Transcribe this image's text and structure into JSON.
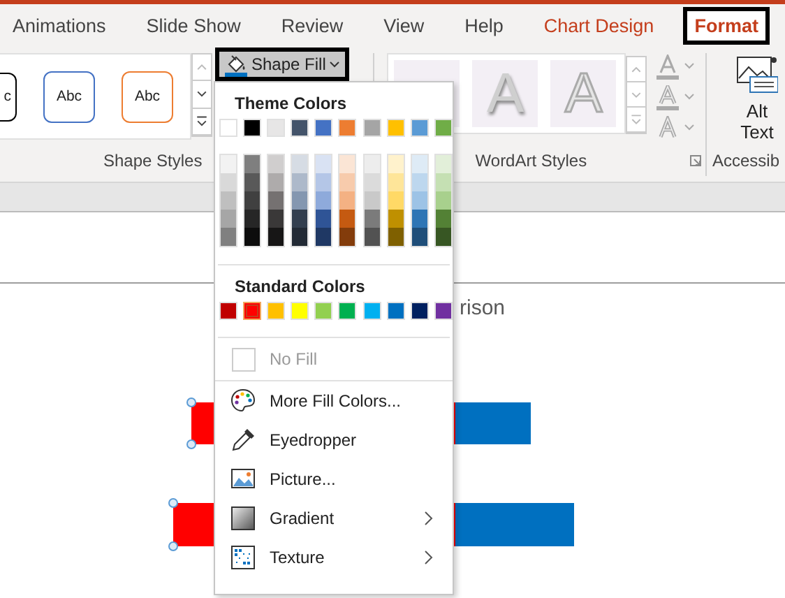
{
  "tabs": [
    {
      "label": "Animations",
      "kind": "normal",
      "selected": false
    },
    {
      "label": "Slide Show",
      "kind": "normal",
      "selected": false
    },
    {
      "label": "Review",
      "kind": "normal",
      "selected": false
    },
    {
      "label": "View",
      "kind": "normal",
      "selected": false
    },
    {
      "label": "Help",
      "kind": "normal",
      "selected": false
    },
    {
      "label": "Chart Design",
      "kind": "contextual",
      "selected": false
    },
    {
      "label": "Format",
      "kind": "contextual",
      "selected": true
    }
  ],
  "shape_styles": {
    "label": "Shape Styles",
    "items": [
      {
        "text": "c",
        "color": "#000000"
      },
      {
        "text": "Abc",
        "color": "#4472c4"
      },
      {
        "text": "Abc",
        "color": "#ed7d31"
      }
    ]
  },
  "shape_fill": {
    "label": "Shape Fill",
    "pressed": true
  },
  "wordart_styles": {
    "label": "WordArt Styles",
    "items": [
      {
        "text": "A",
        "kind": "shadow"
      },
      {
        "text": "A",
        "kind": "outline"
      }
    ]
  },
  "accessibility": {
    "label": "Accessib",
    "button": "Alt Text"
  },
  "chart": {
    "title": "rison",
    "series": [
      {
        "color": "#ff0000",
        "selected": true
      },
      {
        "color": "#0070c0",
        "selected": false
      }
    ]
  },
  "menu": {
    "theme_header": "Theme Colors",
    "theme_colors": [
      {
        "color": "#ffffff",
        "selected": false,
        "shades": [
          {
            "color": "#f2f2f2",
            "selected": false
          },
          {
            "color": "#d9d9d9",
            "selected": false
          },
          {
            "color": "#bfbfbf",
            "selected": false
          },
          {
            "color": "#a6a6a6",
            "selected": false
          },
          {
            "color": "#808080",
            "selected": false
          }
        ]
      },
      {
        "color": "#000000",
        "selected": false,
        "shades": [
          {
            "color": "#7f7f7f",
            "selected": false
          },
          {
            "color": "#595959",
            "selected": false
          },
          {
            "color": "#404040",
            "selected": false
          },
          {
            "color": "#262626",
            "selected": false
          },
          {
            "color": "#0d0d0d",
            "selected": false
          }
        ]
      },
      {
        "color": "#e7e6e6",
        "selected": false,
        "shades": [
          {
            "color": "#d0cece",
            "selected": false
          },
          {
            "color": "#aeabab",
            "selected": false
          },
          {
            "color": "#757171",
            "selected": false
          },
          {
            "color": "#3a3838",
            "selected": false
          },
          {
            "color": "#171616",
            "selected": false
          }
        ]
      },
      {
        "color": "#44546a",
        "selected": false,
        "shades": [
          {
            "color": "#d6dce4",
            "selected": false
          },
          {
            "color": "#adb9ca",
            "selected": false
          },
          {
            "color": "#8497b0",
            "selected": false
          },
          {
            "color": "#333f4f",
            "selected": false
          },
          {
            "color": "#222a35",
            "selected": false
          }
        ]
      },
      {
        "color": "#4472c4",
        "selected": false,
        "shades": [
          {
            "color": "#d9e2f3",
            "selected": false
          },
          {
            "color": "#b4c6e7",
            "selected": false
          },
          {
            "color": "#8eaadb",
            "selected": false
          },
          {
            "color": "#2f5496",
            "selected": false
          },
          {
            "color": "#1f3864",
            "selected": false
          }
        ]
      },
      {
        "color": "#ed7d31",
        "selected": false,
        "shades": [
          {
            "color": "#fbe5d5",
            "selected": false
          },
          {
            "color": "#f7cbac",
            "selected": false
          },
          {
            "color": "#f4b183",
            "selected": false
          },
          {
            "color": "#c55a11",
            "selected": false
          },
          {
            "color": "#833c0b",
            "selected": false
          }
        ]
      },
      {
        "color": "#a5a5a5",
        "selected": false,
        "shades": [
          {
            "color": "#ededed",
            "selected": false
          },
          {
            "color": "#dbdbdb",
            "selected": false
          },
          {
            "color": "#c9c9c9",
            "selected": false
          },
          {
            "color": "#7b7b7b",
            "selected": false
          },
          {
            "color": "#525252",
            "selected": false
          }
        ]
      },
      {
        "color": "#ffc000",
        "selected": false,
        "shades": [
          {
            "color": "#fff2cc",
            "selected": false
          },
          {
            "color": "#fee599",
            "selected": false
          },
          {
            "color": "#ffd966",
            "selected": false
          },
          {
            "color": "#bf9000",
            "selected": false
          },
          {
            "color": "#7f6000",
            "selected": false
          }
        ]
      },
      {
        "color": "#5b9bd5",
        "selected": false,
        "shades": [
          {
            "color": "#deebf6",
            "selected": false
          },
          {
            "color": "#bdd7ee",
            "selected": false
          },
          {
            "color": "#9dc3e6",
            "selected": false
          },
          {
            "color": "#2e75b5",
            "selected": false
          },
          {
            "color": "#1f4e79",
            "selected": false
          }
        ]
      },
      {
        "color": "#70ad47",
        "selected": false,
        "shades": [
          {
            "color": "#e2efd9",
            "selected": false
          },
          {
            "color": "#c5e0b3",
            "selected": false
          },
          {
            "color": "#a8d08d",
            "selected": false
          },
          {
            "color": "#538135",
            "selected": false
          },
          {
            "color": "#375623",
            "selected": false
          }
        ]
      }
    ],
    "standard_header": "Standard Colors",
    "standard_colors": [
      {
        "color": "#c00000",
        "selected": false
      },
      {
        "color": "#ff0000",
        "selected": true
      },
      {
        "color": "#ffc000",
        "selected": false
      },
      {
        "color": "#ffff00",
        "selected": false
      },
      {
        "color": "#92d050",
        "selected": false
      },
      {
        "color": "#00b050",
        "selected": false
      },
      {
        "color": "#00b0f0",
        "selected": false
      },
      {
        "color": "#0070c0",
        "selected": false
      },
      {
        "color": "#002060",
        "selected": false
      },
      {
        "color": "#7030a0",
        "selected": false
      }
    ],
    "no_fill": {
      "label": "No Fill",
      "disabled": true
    },
    "items": [
      {
        "label": "More Fill Colors...",
        "kind": "palette",
        "submenu": false
      },
      {
        "label": "Eyedropper",
        "kind": "eyedropper",
        "submenu": false
      },
      {
        "label": "Picture...",
        "kind": "picture",
        "submenu": false
      },
      {
        "label": "Gradient",
        "kind": "gradient",
        "submenu": true
      },
      {
        "label": "Texture",
        "kind": "texture",
        "submenu": true
      }
    ]
  }
}
